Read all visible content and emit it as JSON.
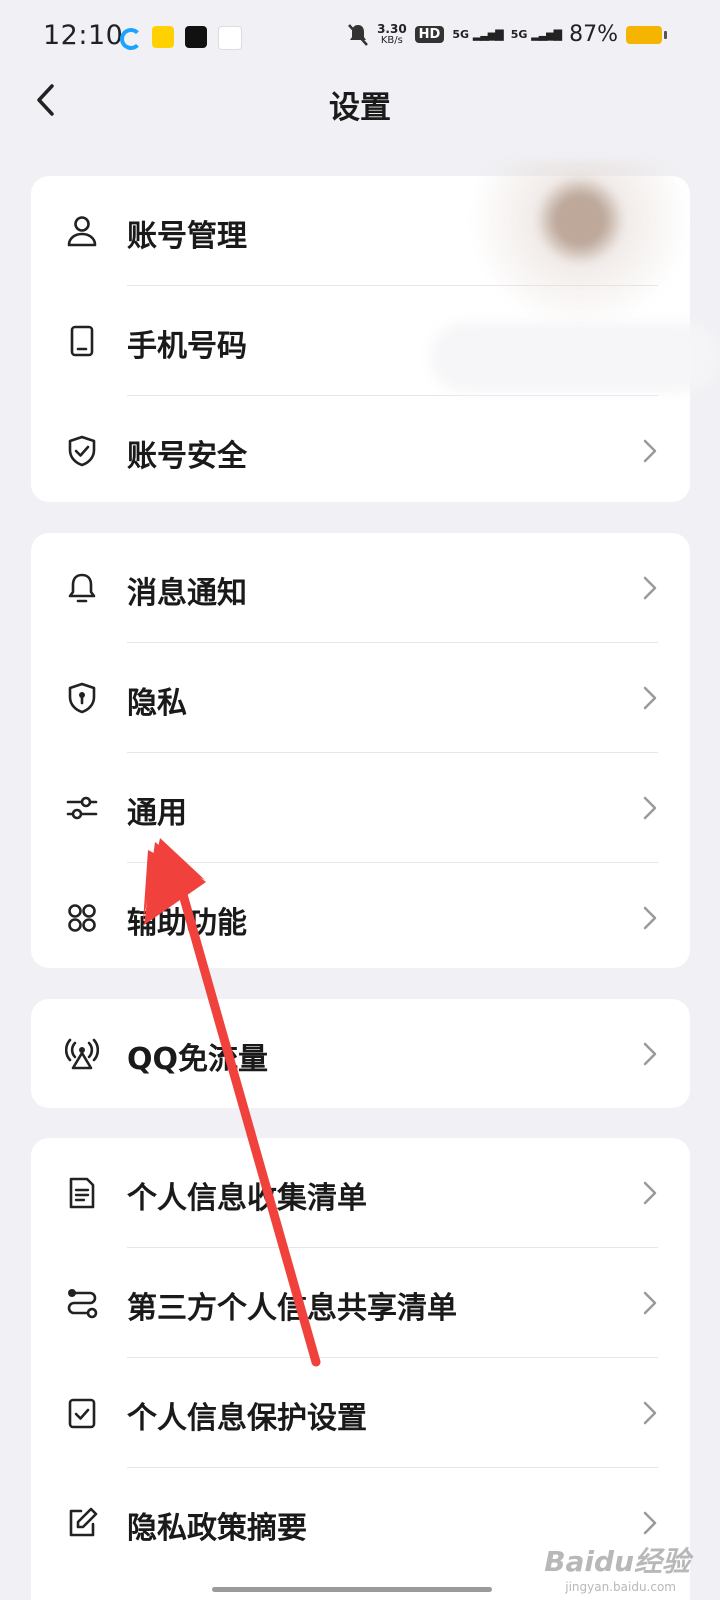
{
  "status_bar": {
    "time": "12:10",
    "net_speed_value": "3.30",
    "net_speed_unit": "KB/s",
    "hd_badge": "HD",
    "sim1_label": "5G",
    "sim2_label": "5G",
    "battery_percent": "87%",
    "battery_color": "#f5b400"
  },
  "navbar": {
    "back_icon": "chevron-left-icon",
    "title": "设置"
  },
  "groups": [
    {
      "items": [
        {
          "label": "账号管理",
          "icon": "user-icon",
          "chevron": false
        },
        {
          "label": "手机号码",
          "icon": "phone-icon",
          "chevron": false
        },
        {
          "label": "账号安全",
          "icon": "shield-check-icon",
          "chevron": true
        }
      ]
    },
    {
      "items": [
        {
          "label": "消息通知",
          "icon": "bell-icon",
          "chevron": true
        },
        {
          "label": "隐私",
          "icon": "privacy-shield-icon",
          "chevron": true
        },
        {
          "label": "通用",
          "icon": "sliders-icon",
          "chevron": true
        },
        {
          "label": "辅助功能",
          "icon": "command-icon",
          "chevron": true
        }
      ]
    },
    {
      "items": [
        {
          "label": "QQ免流量",
          "icon": "signal-tower-icon",
          "chevron": true
        }
      ]
    },
    {
      "items": [
        {
          "label": "个人信息收集清单",
          "icon": "document-icon",
          "chevron": true
        },
        {
          "label": "第三方个人信息共享清单",
          "icon": "share-route-icon",
          "chevron": true
        },
        {
          "label": "个人信息保护设置",
          "icon": "check-square-icon",
          "chevron": true
        },
        {
          "label": "隐私政策摘要",
          "icon": "edit-icon",
          "chevron": true
        }
      ]
    }
  ],
  "annotation": {
    "arrow_color": "#f0413c",
    "points_to": "通用"
  },
  "watermark": {
    "text": "Baidu经验",
    "sub": "jingyan.baidu.com"
  }
}
